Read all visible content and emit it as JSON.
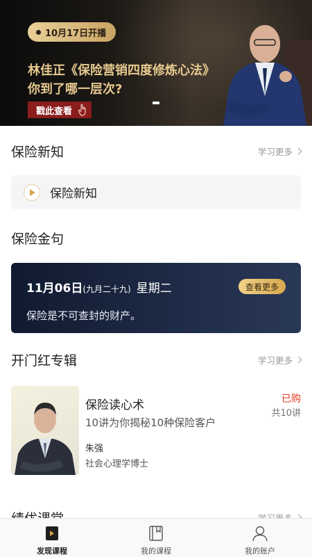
{
  "banner": {
    "live_badge": "10月17日开播",
    "title_line1": "林佳正《保险营销四度修炼心法》",
    "title_line2": "你到了哪一层次?",
    "watch_button": "戳此查看",
    "colors": {
      "gold": "#e6c98f",
      "button_red": "#8c1d1d"
    }
  },
  "section_news": {
    "title": "保险新知",
    "more": "学习更多",
    "card_label": "保险新知"
  },
  "section_quote": {
    "title": "保险金句",
    "date": "11月06日",
    "lunar": "(九月二十九)",
    "weekday": "星期二",
    "see_more": "查看更多",
    "quote": "保险是不可查封的财产。"
  },
  "section_album": {
    "title": "开门红专辑",
    "more": "学习更多",
    "item": {
      "name": "保险读心术",
      "desc": "10讲为你揭秘10种保险客户",
      "author": "朱强",
      "author_title": "社会心理学博士",
      "status": "已购",
      "lessons": "共10讲"
    }
  },
  "section_excellent": {
    "title": "绩优课堂",
    "more": "学习更多"
  },
  "tabbar": {
    "tabs": [
      {
        "label": "发现课程",
        "icon": "discover-icon",
        "active": true
      },
      {
        "label": "我的课程",
        "icon": "book-icon",
        "active": false
      },
      {
        "label": "我的账户",
        "icon": "user-icon",
        "active": false
      }
    ]
  }
}
